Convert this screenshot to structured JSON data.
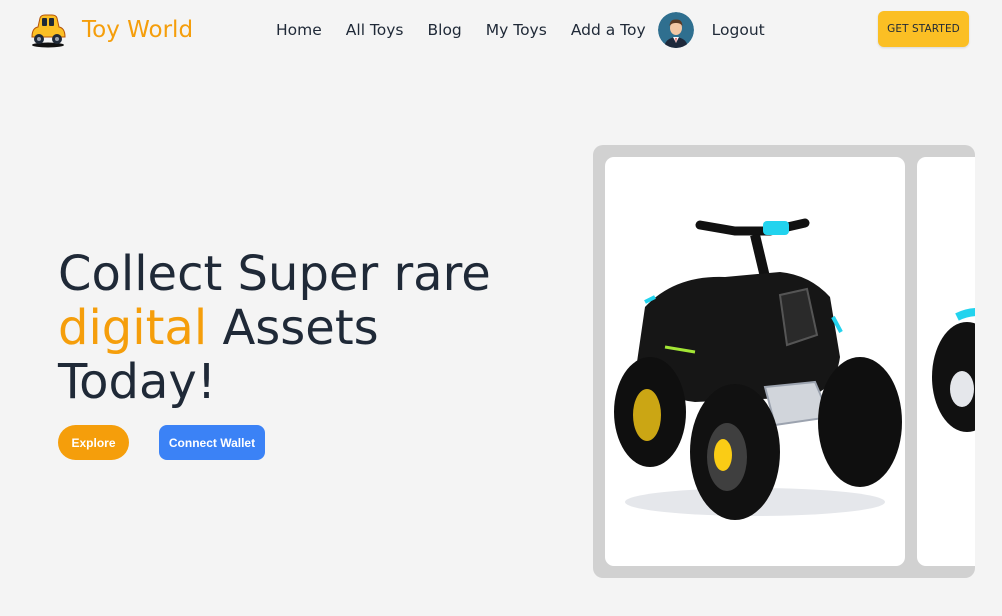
{
  "brand": {
    "name": "Toy World",
    "logo_icon": "toy-car-icon"
  },
  "nav": {
    "items": [
      "Home",
      "All Toys",
      "Blog",
      "My Toys",
      "Add a Toy"
    ],
    "logout": "Logout",
    "cta": "GET STARTED",
    "avatar_icon": "user-avatar-icon"
  },
  "hero": {
    "title_line1": "Collect Super rare",
    "title_accent": "digital",
    "title_line2_rest": " Assets",
    "title_line3": "Today!",
    "explore_label": "Explore",
    "wallet_label": "Connect Wallet"
  },
  "carousel": {
    "slides": [
      {
        "image_icon": "atv-ride-on-toy-image"
      },
      {
        "image_icon": "atv-ride-on-toy-image"
      }
    ]
  },
  "colors": {
    "accent": "#f59e0b",
    "cta": "#fbbf24",
    "primary_blue": "#3b82f6",
    "text": "#1f2937",
    "background": "#f4f4f4"
  }
}
